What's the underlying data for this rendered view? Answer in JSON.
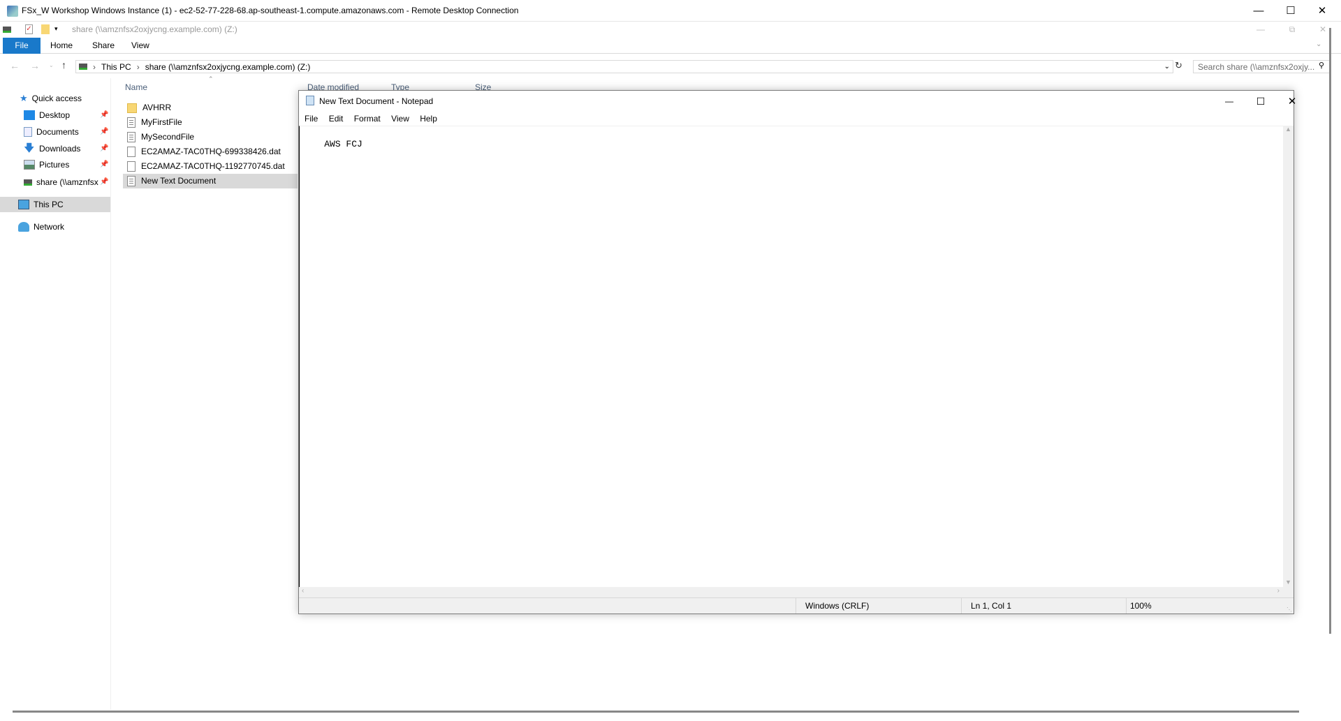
{
  "rdp": {
    "title": "FSx_W Workshop Windows Instance (1) - ec2-52-77-228-68.ap-southeast-1.compute.amazonaws.com - Remote Desktop Connection"
  },
  "explorer": {
    "qat_title": "share (\\\\amznfsx2oxjycng.example.com) (Z:)",
    "ribbon_tabs": [
      "File",
      "Home",
      "Share",
      "View"
    ],
    "address": {
      "crumbs": [
        "This PC",
        "share (\\\\amznfsx2oxjycng.example.com) (Z:)"
      ]
    },
    "search_placeholder": "Search share (\\\\amznfsx2oxjy...",
    "nav": {
      "quick_access": "Quick access",
      "items": [
        "Desktop",
        "Documents",
        "Downloads",
        "Pictures",
        "share (\\\\amznfsx"
      ],
      "this_pc": "This PC",
      "network": "Network"
    },
    "columns": [
      "Name",
      "Date modified",
      "Type",
      "Size"
    ],
    "files": [
      {
        "name": "AVHRR",
        "type": "folder"
      },
      {
        "name": "MyFirstFile",
        "type": "text"
      },
      {
        "name": "MySecondFile",
        "type": "text"
      },
      {
        "name": "EC2AMAZ-TAC0THQ-699338426.dat",
        "type": "file"
      },
      {
        "name": "EC2AMAZ-TAC0THQ-1192770745.dat",
        "type": "file"
      },
      {
        "name": "New Text Document",
        "type": "text",
        "selected": true
      }
    ]
  },
  "notepad": {
    "title": "New Text Document - Notepad",
    "menu": [
      "File",
      "Edit",
      "Format",
      "View",
      "Help"
    ],
    "content": "AWS FCJ",
    "status": {
      "line_ending": "Windows (CRLF)",
      "position": "Ln 1, Col 1",
      "zoom": "100%"
    }
  },
  "colors": {
    "accent": "#1979ca",
    "selection": "#d9d9d9"
  }
}
